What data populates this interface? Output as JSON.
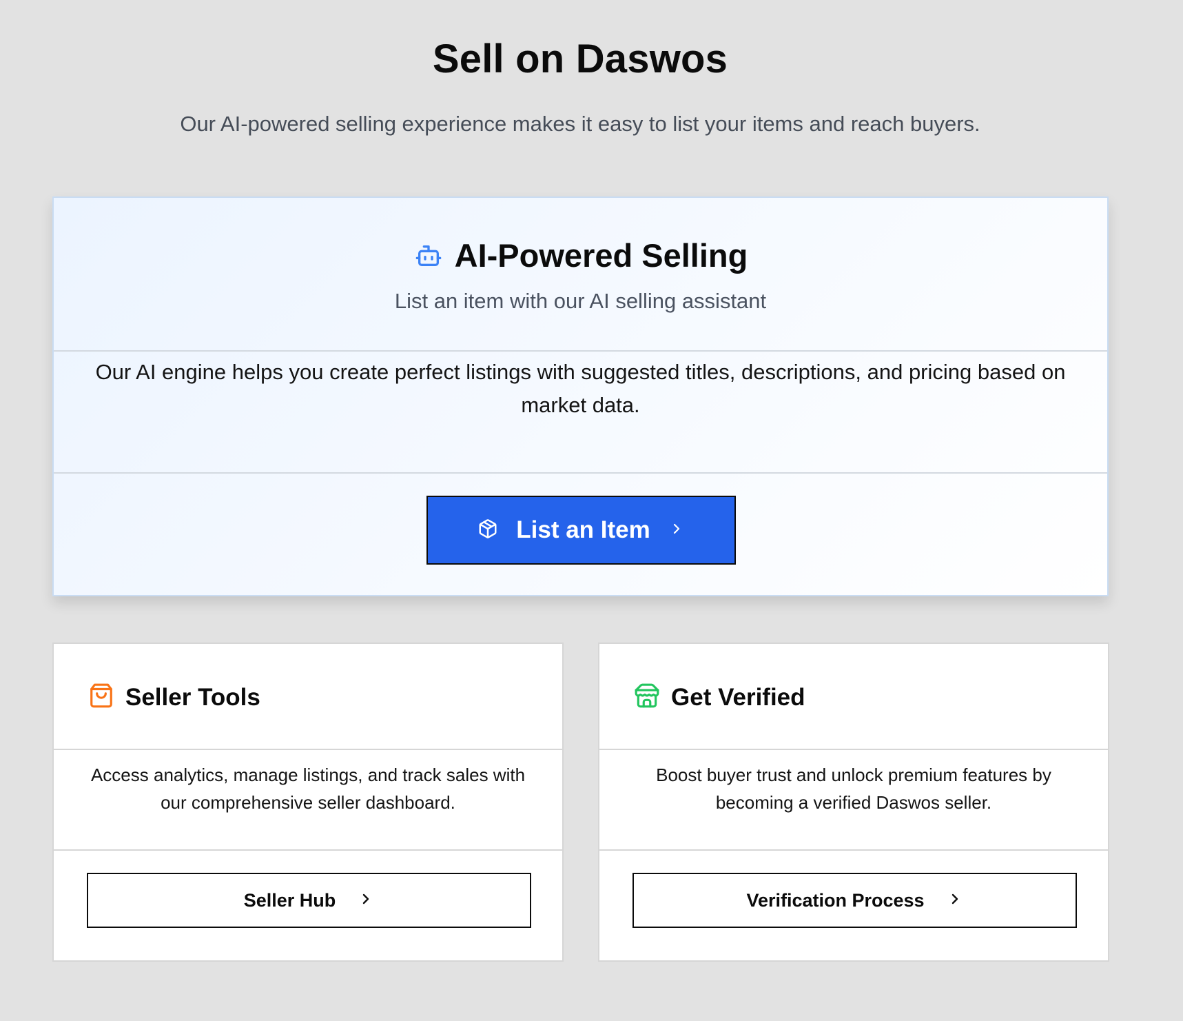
{
  "page": {
    "title": "Sell on Daswos",
    "subtitle": "Our AI-powered selling experience makes it easy to list your items and reach buyers."
  },
  "ai_card": {
    "icon": "bot-icon",
    "title": "AI-Powered Selling",
    "subtitle": "List an item with our AI selling assistant",
    "body": "Our AI engine helps you create perfect listings with suggested titles, descriptions, and pricing based on market data.",
    "button": {
      "icon": "package-icon",
      "label": "List an Item",
      "trailing_icon": "chevron-right-icon"
    }
  },
  "seller_tools": {
    "icon": "shopping-bag-icon",
    "title": "Seller Tools",
    "body": "Access analytics, manage listings, and track sales with our comprehensive seller dashboard.",
    "button_label": "Seller Hub"
  },
  "get_verified": {
    "icon": "store-icon",
    "title": "Get Verified",
    "body": "Boost buyer trust and unlock premium features by becoming a verified Daswos seller.",
    "button_label": "Verification Process"
  },
  "colors": {
    "background": "#e2e2e2",
    "primary_button": "#2563eb",
    "bot_icon": "#3b82f6",
    "bag_icon": "#f97316",
    "store_icon": "#22c55e"
  }
}
